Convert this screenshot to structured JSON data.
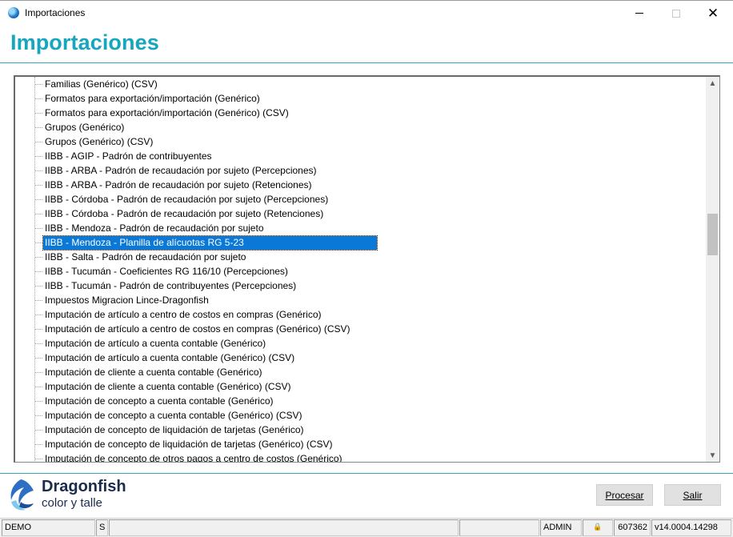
{
  "window": {
    "title": "Importaciones",
    "minimize_glyph": "",
    "close_glyph": "✕"
  },
  "header": {
    "title": "Importaciones"
  },
  "tree": {
    "items": [
      "Familias (Genérico) (CSV)",
      "Formatos para exportación/importación (Genérico)",
      "Formatos para exportación/importación (Genérico) (CSV)",
      "Grupos (Genérico)",
      "Grupos (Genérico) (CSV)",
      "IIBB - AGIP - Padrón de contribuyentes",
      "IIBB - ARBA - Padrón de recaudación por sujeto (Percepciones)",
      "IIBB - ARBA - Padrón de recaudación por sujeto (Retenciones)",
      "IIBB - Córdoba - Padrón de recaudación por sujeto (Percepciones)",
      "IIBB - Córdoba - Padrón de recaudación por sujeto (Retenciones)",
      "IIBB - Mendoza - Padrón de recaudación por sujeto",
      "IIBB - Mendoza - Planilla de alícuotas RG 5-23",
      "IIBB - Salta - Padrón de recaudación por sujeto",
      "IIBB - Tucumán - Coeficientes RG 116/10 (Percepciones)",
      "IIBB - Tucumán - Padrón de contribuyentes (Percepciones)",
      "Impuestos  Migracion Lince-Dragonfish",
      "Imputación de artículo a centro de costos en compras (Genérico)",
      "Imputación de artículo a centro de costos en compras (Genérico) (CSV)",
      "Imputación de artículo a cuenta contable (Genérico)",
      "Imputación de artículo a cuenta contable (Genérico) (CSV)",
      "Imputación de cliente a cuenta contable (Genérico)",
      "Imputación de cliente a cuenta contable (Genérico) (CSV)",
      "Imputación de concepto a cuenta contable (Genérico)",
      "Imputación de concepto a cuenta contable (Genérico) (CSV)",
      "Imputación de concepto de liquidación de tarjetas (Genérico)",
      "Imputación de concepto de liquidación de tarjetas (Genérico) (CSV)",
      "Imputación de concepto de otros pagos a centro de costos (Genérico)"
    ],
    "selected_index": 11,
    "scroll_up_glyph": "▲",
    "scroll_down_glyph": "▼",
    "scroll_position": 0.39
  },
  "brand": {
    "name": "Dragonfish",
    "tagline": "color y talle"
  },
  "buttons": {
    "procesar": "Procesar",
    "salir": "Salir"
  },
  "statusbar": {
    "mode": "DEMO",
    "flag": "S",
    "user": "ADMIN",
    "lock_glyph": "🔒",
    "number": "607362",
    "version": "v14.0004.14298"
  },
  "colors": {
    "accent": "#16a6bd",
    "selection": "#0a78d7",
    "brand_text": "#1a2b4b"
  }
}
